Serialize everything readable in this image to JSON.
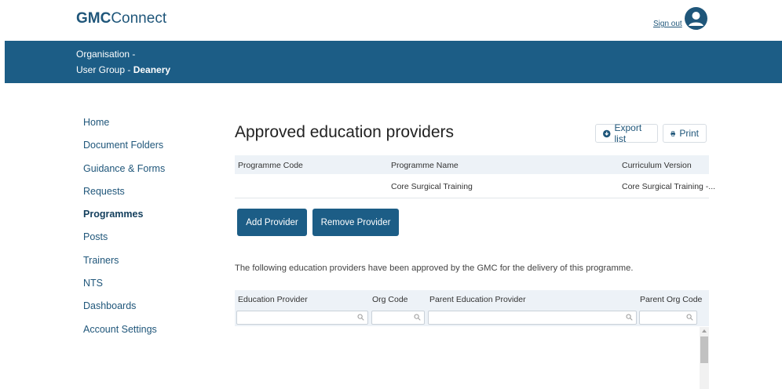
{
  "header": {
    "logo_bold": "GMC",
    "logo_rest": "Connect",
    "signout": "Sign out"
  },
  "banner": {
    "organisation": "Organisation -",
    "user_group_prefix": "User Group - ",
    "user_group": "Deanery"
  },
  "sidebar": {
    "items": [
      {
        "label": "Home"
      },
      {
        "label": "Document Folders"
      },
      {
        "label": "Guidance & Forms"
      },
      {
        "label": "Requests"
      },
      {
        "label": "Programmes",
        "active": true
      },
      {
        "label": "Posts"
      },
      {
        "label": "Trainers"
      },
      {
        "label": "NTS"
      },
      {
        "label": "Dashboards"
      },
      {
        "label": "Account Settings"
      }
    ]
  },
  "main": {
    "title": "Approved education providers",
    "export_label": "Export list",
    "print_label": "Print",
    "programme_table": {
      "headers": [
        "Programme Code",
        "Programme Name",
        "Curriculum Version"
      ],
      "rows": [
        [
          "",
          "Core Surgical Training",
          "Core Surgical Training -..."
        ]
      ]
    },
    "add_provider": "Add Provider",
    "remove_provider": "Remove Provider",
    "info_text": "The following education providers have been approved by the GMC for the delivery of this programme.",
    "providers_table": {
      "headers": [
        "Education Provider",
        "Org Code",
        "Parent Education Provider",
        "Parent Org Code"
      ]
    }
  },
  "colors": {
    "brand": "#1c5d86",
    "text_link": "#1f567a",
    "table_header_bg": "#edf2f7"
  }
}
